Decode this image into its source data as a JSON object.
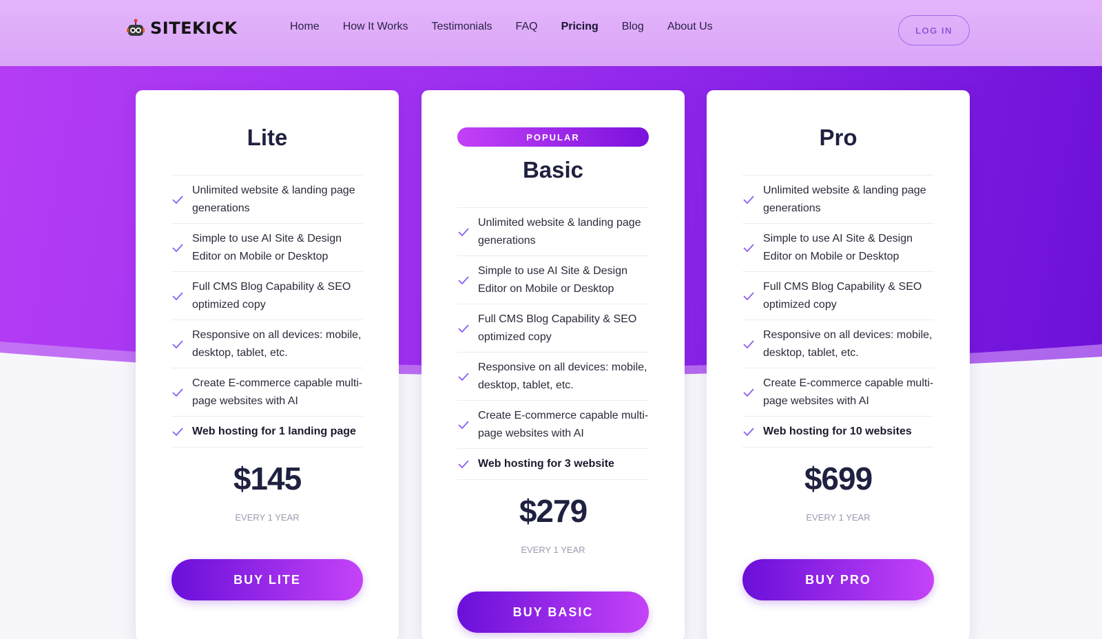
{
  "header": {
    "logo_text": "SITEKICK",
    "nav": [
      "Home",
      "How It Works",
      "Testimonials",
      "FAQ",
      "Pricing",
      "Blog",
      "About Us"
    ],
    "active_nav": "Pricing",
    "login_label": "LOG IN"
  },
  "plans": [
    {
      "name": "Lite",
      "badge": "",
      "features": [
        "Unlimited website & landing page generations",
        "Simple to use AI Site & Design Editor on Mobile or Desktop",
        "Full CMS Blog Capability & SEO optimized copy",
        "Responsive on all devices: mobile, desktop, tablet, etc.",
        "Create E-commerce capable multi-page websites with AI",
        "Web hosting for 1 landing page"
      ],
      "price": "$145",
      "period": "EVERY 1 YEAR",
      "button": "BUY LITE"
    },
    {
      "name": "Basic",
      "badge": "POPULAR",
      "features": [
        "Unlimited website & landing page generations",
        "Simple to use AI Site & Design Editor on Mobile or Desktop",
        "Full CMS Blog Capability & SEO optimized copy",
        "Responsive on all devices: mobile, desktop, tablet, etc.",
        "Create E-commerce capable multi-page websites with AI",
        "Web hosting for 3 website"
      ],
      "price": "$279",
      "period": "EVERY 1 YEAR",
      "button": "BUY BASIC"
    },
    {
      "name": "Pro",
      "badge": "",
      "features": [
        "Unlimited website & landing page generations",
        "Simple to use AI Site & Design Editor on Mobile or Desktop",
        "Full CMS Blog Capability & SEO optimized copy",
        "Responsive on all devices: mobile, desktop, tablet, etc.",
        "Create E-commerce capable multi-page websites with AI",
        "Web hosting for 10 websites"
      ],
      "price": "$699",
      "period": "EVERY 1 YEAR",
      "button": "BUY PRO"
    }
  ],
  "colors": {
    "accent": "#8a2be2",
    "check": "#8b5cf6",
    "text_dark": "#1f2140"
  }
}
